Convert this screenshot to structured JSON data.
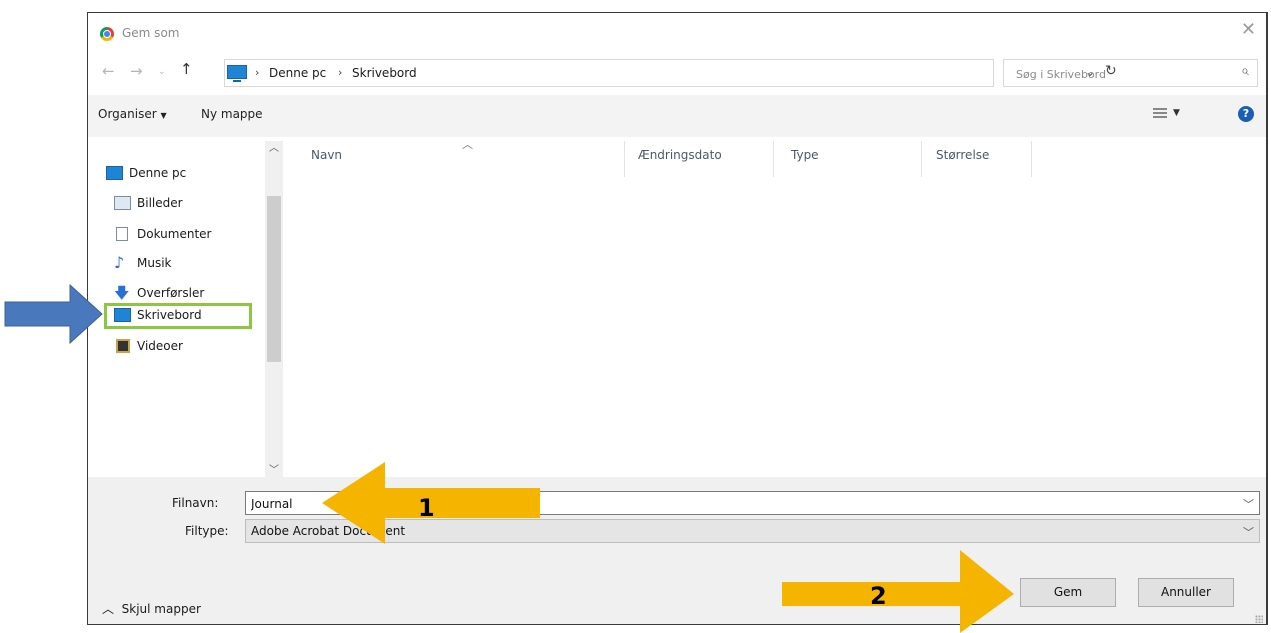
{
  "window": {
    "title": "Gem som"
  },
  "address": {
    "crumbs": [
      "Denne pc",
      "Skrivebord"
    ],
    "search_placeholder": "Søg i Skrivebord"
  },
  "toolbar": {
    "organize": "Organiser",
    "new_folder": "Ny mappe"
  },
  "sidebar": {
    "root": "Denne pc",
    "items": [
      "Billeder",
      "Dokumenter",
      "Musik",
      "Overførsler",
      "Skrivebord",
      "Videoer"
    ],
    "selected": "Skrivebord"
  },
  "columns": [
    "Navn",
    "Ændringsdato",
    "Type",
    "Størrelse"
  ],
  "form": {
    "filename_label": "Filnavn:",
    "filename_value": "Journal",
    "filetype_label": "Filtype:",
    "filetype_value": "Adobe Acrobat Document"
  },
  "footer": {
    "hide_folders": "Skjul mapper",
    "save": "Gem",
    "cancel": "Annuller"
  },
  "annotations": {
    "arrow1": "1",
    "arrow2": "2"
  },
  "colors": {
    "arrow_orange": "#f5b400",
    "arrow_blue": "#4a78bd",
    "highlight_green": "#8dc63f"
  }
}
